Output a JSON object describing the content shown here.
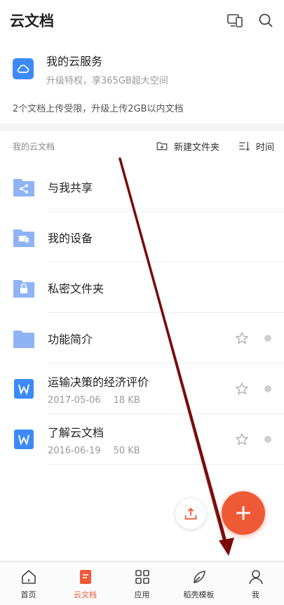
{
  "header": {
    "title": "云文档",
    "icons": [
      "devices-icon",
      "search-icon"
    ]
  },
  "cloud_service": {
    "title": "我的云服务",
    "subtitle": "升级特权，享365GB超大空间",
    "notice": "2个文档上传受限，升级上传2GB以内文档"
  },
  "list": {
    "section_title": "我的云文档",
    "new_folder_label": "新建文件夹",
    "sort_label": "时间",
    "items": [
      {
        "name": "与我共享",
        "icon": "shared-folder-icon"
      },
      {
        "name": "我的设备",
        "icon": "device-folder-icon"
      },
      {
        "name": "私密文件夹",
        "icon": "private-folder-icon"
      },
      {
        "name": "功能简介",
        "icon": "folder-icon"
      },
      {
        "name": "运输决策的经济评价",
        "date": "2017-05-06",
        "size": "18 KB",
        "icon": "word-doc-icon"
      },
      {
        "name": "了解云文档",
        "date": "2016-06-19",
        "size": "50 KB",
        "icon": "word-doc-icon"
      }
    ]
  },
  "tabs": [
    {
      "label": "首页",
      "icon": "home-icon"
    },
    {
      "label": "云文档",
      "icon": "cloud-doc-icon",
      "active": true
    },
    {
      "label": "应用",
      "icon": "apps-grid-icon"
    },
    {
      "label": "稻壳模板",
      "icon": "leaf-icon"
    },
    {
      "label": "我",
      "icon": "user-icon"
    }
  ],
  "colors": {
    "accent": "#ee5a36",
    "blue": "#3d8af7",
    "folder": "#8fb4f5",
    "arrow": "#7a0a0a"
  }
}
